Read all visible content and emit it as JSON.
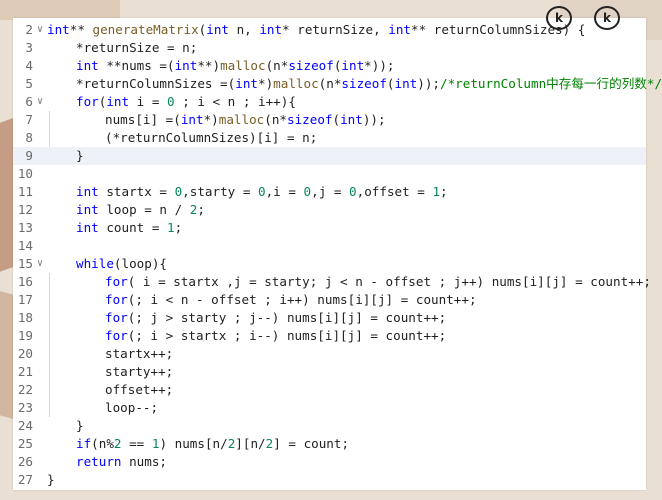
{
  "title": "",
  "controls": [
    {
      "label": "k",
      "icon": "collapse-icon"
    },
    {
      "label": "k",
      "icon": "collapse-icon"
    }
  ],
  "colors": {
    "keyword": "#0000ff",
    "function": "#795e26",
    "number": "#098658",
    "comment": "#008000",
    "line_number": "#6b6b6b",
    "current_line": "#eef2f8"
  },
  "editor": {
    "current_line": 9,
    "lines": [
      {
        "num": "2",
        "fold": "v",
        "indent": 0,
        "tokens": [
          [
            "t",
            "int"
          ],
          [
            "p",
            "** "
          ],
          [
            "f",
            "generateMatrix"
          ],
          [
            "p",
            "("
          ],
          [
            "t",
            "int"
          ],
          [
            "p",
            " n, "
          ],
          [
            "t",
            "int"
          ],
          [
            "p",
            "* returnSize, "
          ],
          [
            "t",
            "int"
          ],
          [
            "p",
            "** returnColumnSizes) {"
          ]
        ]
      },
      {
        "num": "3",
        "fold": "",
        "indent": 1,
        "tokens": [
          [
            "p",
            "*returnSize = n;"
          ]
        ]
      },
      {
        "num": "4",
        "fold": "",
        "indent": 1,
        "tokens": [
          [
            "t",
            "int"
          ],
          [
            "p",
            " **nums =("
          ],
          [
            "t",
            "int"
          ],
          [
            "p",
            "**)"
          ],
          [
            "f",
            "malloc"
          ],
          [
            "p",
            "(n*"
          ],
          [
            "k",
            "sizeof"
          ],
          [
            "p",
            "("
          ],
          [
            "t",
            "int"
          ],
          [
            "p",
            "*));"
          ]
        ]
      },
      {
        "num": "5",
        "fold": "",
        "indent": 1,
        "tokens": [
          [
            "p",
            "*returnColumnSizes =("
          ],
          [
            "t",
            "int"
          ],
          [
            "p",
            "*)"
          ],
          [
            "f",
            "malloc"
          ],
          [
            "p",
            "(n*"
          ],
          [
            "k",
            "sizeof"
          ],
          [
            "p",
            "("
          ],
          [
            "t",
            "int"
          ],
          [
            "p",
            "));"
          ],
          [
            "c",
            "/*returnColumn中存每一行的列数*/"
          ]
        ]
      },
      {
        "num": "6",
        "fold": "v",
        "indent": 1,
        "tokens": [
          [
            "k",
            "for"
          ],
          [
            "p",
            "("
          ],
          [
            "t",
            "int"
          ],
          [
            "p",
            " i = "
          ],
          [
            "n",
            "0"
          ],
          [
            "p",
            " ; i < n ; i++){"
          ]
        ]
      },
      {
        "num": "7",
        "fold": "",
        "indent": 2,
        "tokens": [
          [
            "p",
            "nums[i] =("
          ],
          [
            "t",
            "int"
          ],
          [
            "p",
            "*)"
          ],
          [
            "f",
            "malloc"
          ],
          [
            "p",
            "(n*"
          ],
          [
            "k",
            "sizeof"
          ],
          [
            "p",
            "("
          ],
          [
            "t",
            "int"
          ],
          [
            "p",
            "));"
          ]
        ]
      },
      {
        "num": "8",
        "fold": "",
        "indent": 2,
        "tokens": [
          [
            "p",
            "(*returnColumnSizes)[i] = n;"
          ]
        ]
      },
      {
        "num": "9",
        "fold": "",
        "indent": 1,
        "tokens": [
          [
            "p",
            "}"
          ]
        ]
      },
      {
        "num": "10",
        "fold": "",
        "indent": 0,
        "tokens": []
      },
      {
        "num": "11",
        "fold": "",
        "indent": 1,
        "tokens": [
          [
            "t",
            "int"
          ],
          [
            "p",
            " startx = "
          ],
          [
            "n",
            "0"
          ],
          [
            "p",
            ",starty = "
          ],
          [
            "n",
            "0"
          ],
          [
            "p",
            ",i = "
          ],
          [
            "n",
            "0"
          ],
          [
            "p",
            ",j = "
          ],
          [
            "n",
            "0"
          ],
          [
            "p",
            ",offset = "
          ],
          [
            "n",
            "1"
          ],
          [
            "p",
            ";"
          ]
        ]
      },
      {
        "num": "12",
        "fold": "",
        "indent": 1,
        "tokens": [
          [
            "t",
            "int"
          ],
          [
            "p",
            " loop = n / "
          ],
          [
            "n",
            "2"
          ],
          [
            "p",
            ";"
          ]
        ]
      },
      {
        "num": "13",
        "fold": "",
        "indent": 1,
        "tokens": [
          [
            "t",
            "int"
          ],
          [
            "p",
            " count = "
          ],
          [
            "n",
            "1"
          ],
          [
            "p",
            ";"
          ]
        ]
      },
      {
        "num": "14",
        "fold": "",
        "indent": 0,
        "tokens": []
      },
      {
        "num": "15",
        "fold": "v",
        "indent": 1,
        "tokens": [
          [
            "k",
            "while"
          ],
          [
            "p",
            "(loop){"
          ]
        ]
      },
      {
        "num": "16",
        "fold": "",
        "indent": 2,
        "tokens": [
          [
            "k",
            "for"
          ],
          [
            "p",
            "( i = startx ,j = starty; j < n - offset ; j++) nums[i][j] = count++;"
          ]
        ]
      },
      {
        "num": "17",
        "fold": "",
        "indent": 2,
        "tokens": [
          [
            "k",
            "for"
          ],
          [
            "p",
            "(; i < n - offset ; i++) nums[i][j] = count++;"
          ]
        ]
      },
      {
        "num": "18",
        "fold": "",
        "indent": 2,
        "tokens": [
          [
            "k",
            "for"
          ],
          [
            "p",
            "(; j > starty ; j--) nums[i][j] = count++;"
          ]
        ]
      },
      {
        "num": "19",
        "fold": "",
        "indent": 2,
        "tokens": [
          [
            "k",
            "for"
          ],
          [
            "p",
            "(; i > startx ; i--) nums[i][j] = count++;"
          ]
        ]
      },
      {
        "num": "20",
        "fold": "",
        "indent": 2,
        "tokens": [
          [
            "p",
            "startx++;"
          ]
        ]
      },
      {
        "num": "21",
        "fold": "",
        "indent": 2,
        "tokens": [
          [
            "p",
            "starty++;"
          ]
        ]
      },
      {
        "num": "22",
        "fold": "",
        "indent": 2,
        "tokens": [
          [
            "p",
            "offset++;"
          ]
        ]
      },
      {
        "num": "23",
        "fold": "",
        "indent": 2,
        "tokens": [
          [
            "p",
            "loop--;"
          ]
        ]
      },
      {
        "num": "24",
        "fold": "",
        "indent": 1,
        "tokens": [
          [
            "p",
            "}"
          ]
        ]
      },
      {
        "num": "25",
        "fold": "",
        "indent": 1,
        "tokens": [
          [
            "k",
            "if"
          ],
          [
            "p",
            "(n%"
          ],
          [
            "n",
            "2"
          ],
          [
            "p",
            " == "
          ],
          [
            "n",
            "1"
          ],
          [
            "p",
            ") nums[n/"
          ],
          [
            "n",
            "2"
          ],
          [
            "p",
            "][n/"
          ],
          [
            "n",
            "2"
          ],
          [
            "p",
            "] = count;"
          ]
        ]
      },
      {
        "num": "26",
        "fold": "",
        "indent": 1,
        "tokens": [
          [
            "k",
            "return"
          ],
          [
            "p",
            " nums;"
          ]
        ]
      },
      {
        "num": "27",
        "fold": "",
        "indent": 0,
        "tokens": [
          [
            "p",
            "}"
          ]
        ]
      }
    ]
  }
}
